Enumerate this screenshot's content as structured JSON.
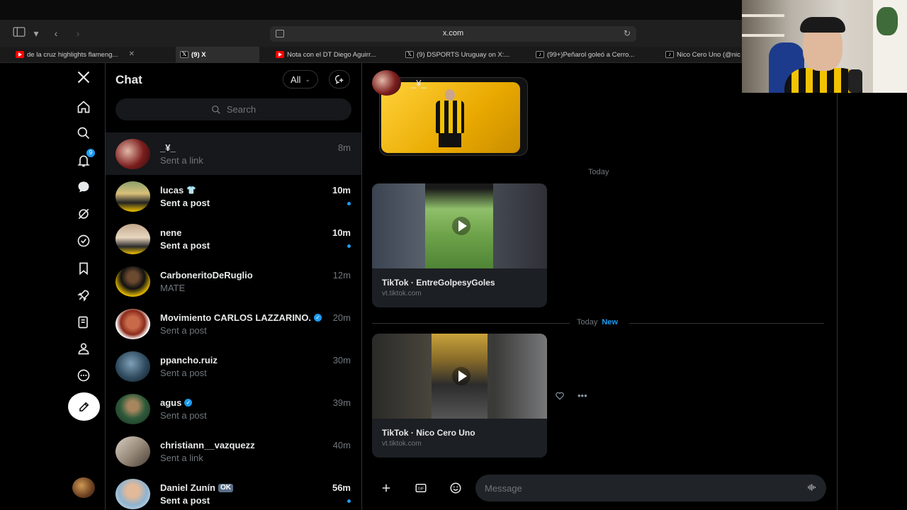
{
  "browser": {
    "url": "x.com",
    "tabs": [
      {
        "title": "de la cruz highlights flameng...",
        "icon": "youtube"
      },
      {
        "title": "(9) X",
        "icon": "x"
      },
      {
        "title": "Nota con el DT Diego Aguirr...",
        "icon": "youtube"
      },
      {
        "title": "(9) DSPORTS Uruguay on X:...",
        "icon": "x"
      },
      {
        "title": "(99+)Peñarol goleó a Cerro...",
        "icon": "tiktok"
      },
      {
        "title": "Nico Cero Uno (@nic",
        "icon": "tiktok"
      }
    ]
  },
  "nav": {
    "notifications_badge": "9"
  },
  "chat": {
    "title": "Chat",
    "filter": "All",
    "search_placeholder": "Search",
    "conversations": [
      {
        "name": "_¥_",
        "preview": "Sent a link",
        "time": "8m",
        "unread": false
      },
      {
        "name": "lucas",
        "preview": "Sent a post",
        "time": "10m",
        "unread": true
      },
      {
        "name": "nene",
        "preview": "Sent a post",
        "time": "10m",
        "unread": true
      },
      {
        "name": "CarboneritoDeRuglio",
        "preview": "MATE",
        "time": "12m",
        "unread": false
      },
      {
        "name": "Movimiento CARLOS LAZZARINO.",
        "preview": "Sent a post",
        "time": "20m",
        "unread": false
      },
      {
        "name": "ppancho.ruiz",
        "preview": "Sent a post",
        "time": "30m",
        "unread": false
      },
      {
        "name": "agus",
        "preview": "Sent a post",
        "time": "39m",
        "unread": false
      },
      {
        "name": "christiann__vazquezz",
        "preview": "Sent a link",
        "time": "40m",
        "unread": false
      },
      {
        "name": "Daniel Zunín",
        "badge": "OK",
        "preview": "Sent a post",
        "time": "56m",
        "unread": true
      }
    ]
  },
  "conversation": {
    "contact_name": "_¥_",
    "separator_1": "Today",
    "separator_2": "Today",
    "new_label": "New",
    "cards": [
      {
        "title": "TikTok · EntreGolpesyGoles",
        "domain": "vt.tiktok.com"
      },
      {
        "title": "TikTok · Nico Cero Uno",
        "domain": "vt.tiktok.com"
      }
    ],
    "message_placeholder": "Message"
  },
  "colors": {
    "accent": "#1d9bf0",
    "background": "#000000",
    "muted": "#71767b"
  }
}
